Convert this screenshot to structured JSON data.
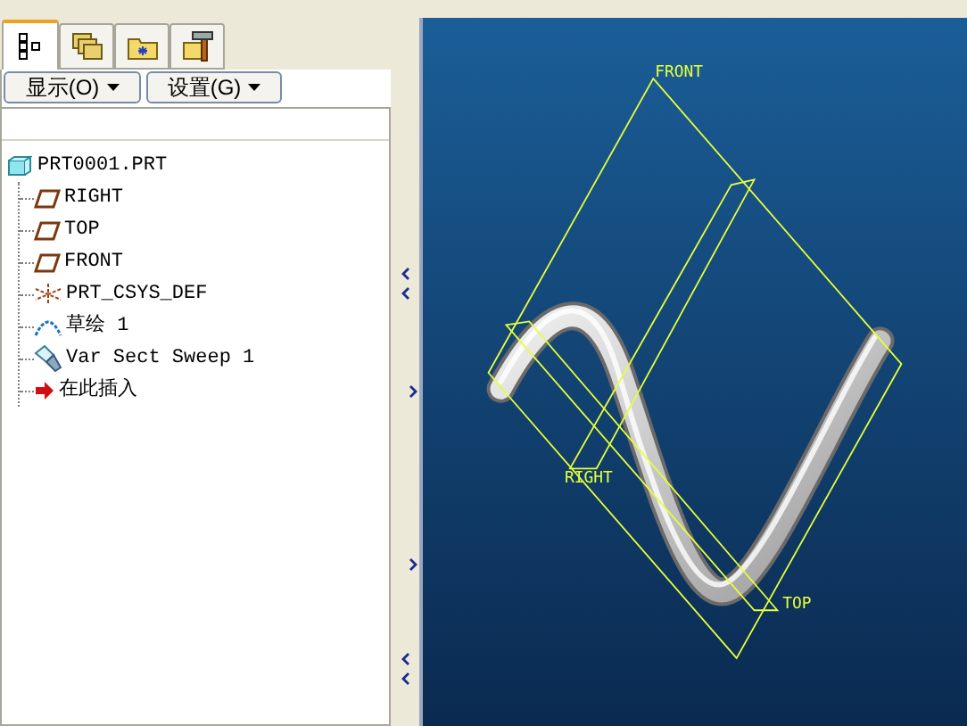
{
  "tabs": [
    {
      "kind": "tree",
      "selected": true
    },
    {
      "kind": "layers",
      "selected": false
    },
    {
      "kind": "folder",
      "selected": false
    },
    {
      "kind": "tools",
      "selected": false
    }
  ],
  "menu_buttons": [
    {
      "label": "显示(O)"
    },
    {
      "label": "设置(G)"
    }
  ],
  "tree": {
    "label": "PRT0001.PRT",
    "kind": "part",
    "children": [
      {
        "label": "RIGHT",
        "kind": "plane"
      },
      {
        "label": "TOP",
        "kind": "plane"
      },
      {
        "label": "FRONT",
        "kind": "plane"
      },
      {
        "label": "PRT_CSYS_DEF",
        "kind": "csys"
      },
      {
        "label": "草绘 1",
        "kind": "sketch"
      },
      {
        "label": "Var Sect Sweep 1",
        "kind": "sweep"
      },
      {
        "label": "在此插入",
        "kind": "insert"
      }
    ]
  },
  "viewport": {
    "datum_labels": [
      "FRONT",
      "RIGHT",
      "TOP"
    ]
  }
}
